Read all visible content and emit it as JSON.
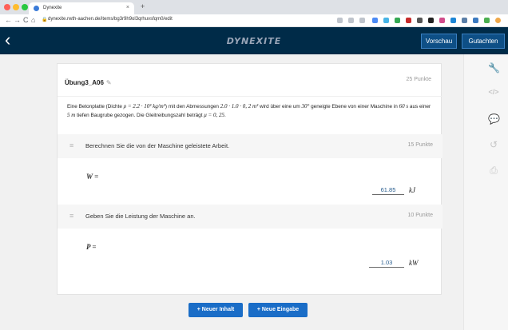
{
  "browser": {
    "tab_title": "Dynexite",
    "tab_close": "×",
    "new_tab": "+",
    "url": "dynexite.rwth-aachen.de/items/bg3r9h9ol3qrhuvsfqm0/edit",
    "nav": {
      "back": "←",
      "forward": "→",
      "reload": "C",
      "home": "⌂",
      "lock": "🔒"
    }
  },
  "header": {
    "back_glyph": "‹",
    "logo": "DYNEXITE",
    "preview_label": "Vorschau",
    "review_label": "Gutachten"
  },
  "item": {
    "title": "Übung3_A06",
    "edit_glyph": "✎",
    "points": "25 Punkte",
    "problem": {
      "p1": "Eine Betonplatte (Dichte ",
      "rho_eq": "ρ = 2.2 · 10³ kg/m³",
      "p2": ") mit den Abmessungen ",
      "dims": "2.0 · 1.0 · 0, 2 m³",
      "p3": " wird über eine um ",
      "angle": "30°",
      "p4": " geneigte Ebene von einer Maschine in ",
      "time": "60 s",
      "p5": " aus einer ",
      "depth": "5 m",
      "p6": " tiefen Baugrube gezogen. Die Gleitreibungszahl beträgt ",
      "mu": "μ = 0, 25",
      "p7": "."
    }
  },
  "subtasks": [
    {
      "handle": "≡",
      "text": "Berechnen Sie die von der Maschine geleistete Arbeit.",
      "points": "15 Punkte",
      "variable": "W =",
      "answer": "61.85",
      "unit": "kJ"
    },
    {
      "handle": "≡",
      "text": "Geben Sie die Leistung der Maschine an.",
      "points": "10 Punkte",
      "variable": "P =",
      "answer": "1.03",
      "unit": "kW"
    }
  ],
  "actions": {
    "new_content": "+ Neuer Inhalt",
    "new_input": "+ Neue Eingabe"
  },
  "rail": {
    "wrench": "🔧",
    "code": "</>",
    "chat": "💬",
    "history": "↺",
    "print": "⎙"
  },
  "colors": {
    "header_bg": "#002b48",
    "button_blue": "#1a6dc7",
    "answer_text": "#2a5e8f"
  }
}
